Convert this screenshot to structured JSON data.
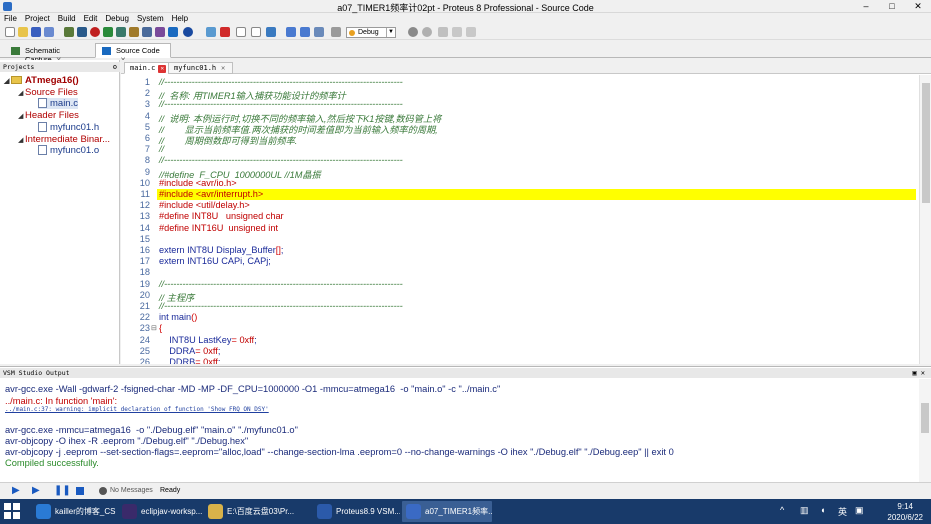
{
  "window": {
    "title": "a07_TIMER1频率计02pt - Proteus 8 Professional - Source Code"
  },
  "menu": [
    "File",
    "Project",
    "Build",
    "Edit",
    "Debug",
    "System",
    "Help"
  ],
  "toolbar": {
    "config_select": "Debug"
  },
  "app_tabs": [
    {
      "label": "Schematic Capture"
    },
    {
      "label": "Source Code"
    }
  ],
  "projects": {
    "header": "Projects",
    "root": "ATmega16()",
    "source_files": "Source Files",
    "source_file_1": "main.c",
    "header_files": "Header Files",
    "header_file_1": "myfunc01.h",
    "intermediate": "Intermediate Binar...",
    "intermediate_1": "myfunc01.o"
  },
  "editor": {
    "tabs": [
      {
        "label": "main.c"
      },
      {
        "label": "myfunc01.h"
      }
    ],
    "highlighted_line": 11,
    "lines": [
      {
        "n": "1",
        "segs": [
          [
            "com",
            "//------------------------------------------------------------------------------"
          ]
        ]
      },
      {
        "n": "2",
        "segs": [
          [
            "com",
            "//  名称: 用TIMER1输入捕获功能设计的频率计"
          ]
        ]
      },
      {
        "n": "3",
        "segs": [
          [
            "com",
            "//------------------------------------------------------------------------------"
          ]
        ]
      },
      {
        "n": "4",
        "segs": [
          [
            "com",
            "//  说明: 本例运行时,切换不同的频率输入,然后按下K1按键,数码管上将"
          ]
        ]
      },
      {
        "n": "5",
        "segs": [
          [
            "com",
            "//        显示当前频率值.两次捕获的时间差值即为当前输入频率的周期,"
          ]
        ]
      },
      {
        "n": "6",
        "segs": [
          [
            "com",
            "//        周期倒数即可得到当前频率."
          ]
        ]
      },
      {
        "n": "7",
        "segs": [
          [
            "com",
            "//"
          ]
        ]
      },
      {
        "n": "8",
        "segs": [
          [
            "com",
            "//------------------------------------------------------------------------------"
          ]
        ]
      },
      {
        "n": "9",
        "segs": [
          [
            "com",
            "//#define  F_CPU  1000000UL //1M晶振"
          ]
        ]
      },
      {
        "n": "10",
        "segs": [
          [
            "pp",
            "#include <avr/io.h>"
          ]
        ]
      },
      {
        "n": "11",
        "segs": [
          [
            "pp",
            "#include <avr/interrupt.h>"
          ]
        ]
      },
      {
        "n": "12",
        "segs": [
          [
            "pp",
            "#include <util/delay.h>"
          ]
        ]
      },
      {
        "n": "13",
        "segs": [
          [
            "pp",
            "#define INT8U   unsigned char"
          ]
        ]
      },
      {
        "n": "14",
        "segs": [
          [
            "pp",
            "#define INT16U  unsigned int"
          ]
        ]
      },
      {
        "n": "15",
        "segs": []
      },
      {
        "n": "16",
        "segs": [
          [
            "kw",
            "extern INT8U Display_Buffer"
          ],
          [
            "p",
            "[]"
          ],
          [
            "kw",
            ";"
          ]
        ]
      },
      {
        "n": "17",
        "segs": [
          [
            "kw",
            "extern INT16U CAPi, CAPj;"
          ]
        ]
      },
      {
        "n": "18",
        "segs": []
      },
      {
        "n": "19",
        "segs": [
          [
            "com",
            "//------------------------------------------------------------------------------"
          ]
        ]
      },
      {
        "n": "20",
        "segs": [
          [
            "com",
            "// 主程序"
          ]
        ]
      },
      {
        "n": "21",
        "segs": [
          [
            "com",
            "//------------------------------------------------------------------------------"
          ]
        ]
      },
      {
        "n": "22",
        "segs": [
          [
            "kw",
            "int main"
          ],
          [
            "p",
            "()"
          ]
        ]
      },
      {
        "n": "23",
        "segs": [
          [
            "p",
            "{"
          ]
        ]
      },
      {
        "n": "24",
        "segs": [
          [
            "kw",
            "    INT8U LastKey"
          ],
          [
            "p",
            "="
          ],
          [
            "num",
            " 0xff"
          ],
          [
            "kw",
            ";"
          ]
        ]
      },
      {
        "n": "25",
        "segs": [
          [
            "kw",
            "    DDRA"
          ],
          [
            "p",
            "="
          ],
          [
            "num",
            " 0xff"
          ],
          [
            "kw",
            ";"
          ]
        ]
      },
      {
        "n": "26",
        "segs": [
          [
            "kw",
            "    DDRB"
          ],
          [
            "p",
            "="
          ],
          [
            "num",
            " 0xff"
          ],
          [
            "kw",
            ";"
          ]
        ]
      }
    ]
  },
  "output": {
    "header": "VSM Studio Output",
    "lines": [
      {
        "cls": "",
        "text": "avr-gcc.exe -Wall -gdwarf-2 -fsigned-char -MD -MP -DF_CPU=1000000 -O1 -mmcu=atmega16  -o \"main.o\" -c \"../main.c\""
      },
      {
        "cls": "red",
        "text": "../main.c: In function 'main':"
      },
      {
        "cls": "warn",
        "text": "../main.c:37: warning: implicit declaration of function 'Show_FRQ_ON_DSY'"
      },
      {
        "cls": "",
        "text": ""
      },
      {
        "cls": "",
        "text": "avr-gcc.exe -mmcu=atmega16  -o \"./Debug.elf\" \"main.o\" \"./myfunc01.o\""
      },
      {
        "cls": "",
        "text": "avr-objcopy -O ihex -R .eeprom \"./Debug.elf\" \"./Debug.hex\""
      },
      {
        "cls": "",
        "text": "avr-objcopy -j .eeprom --set-section-flags=.eeprom=\"alloc,load\" --change-section-lma .eeprom=0 --no-change-warnings -O ihex \"./Debug.elf\" \"./Debug.eep\" || exit 0"
      },
      {
        "cls": "green",
        "text": "Compiled successfully."
      }
    ]
  },
  "status": {
    "messages": "No Messages",
    "state": "Ready"
  },
  "taskbar": {
    "items": [
      {
        "label": "kailler的博客_CS...",
        "color": "#2a7ad4"
      },
      {
        "label": "eclipjav-worksp...",
        "color": "#3a2a6a"
      },
      {
        "label": "E:\\百度云盘03\\Pr...",
        "color": "#d8b24a"
      },
      {
        "label": "Proteus8.9 VSM...",
        "color": "#2b5aaa"
      },
      {
        "label": "a07_TIMER1频率...",
        "color": "#3a6ac4"
      }
    ],
    "time": "9:14",
    "date": "2020/6/22",
    "ime": "英"
  },
  "colors": {
    "highlight": "#ffff00",
    "taskbar": "#183a6a"
  }
}
